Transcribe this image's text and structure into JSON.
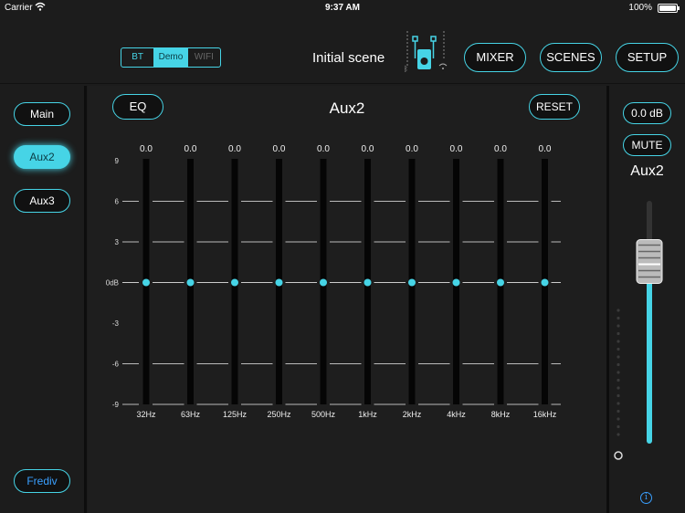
{
  "status": {
    "carrier": "Carrier",
    "time": "9:37 AM",
    "battery": "100%"
  },
  "header": {
    "connection_modes": [
      {
        "label": "BT",
        "active": false
      },
      {
        "label": "Demo",
        "active": true
      },
      {
        "label": "WIFI",
        "active": false
      }
    ],
    "scene_name": "Initial scene",
    "nav": {
      "mixer": "MIXER",
      "scenes": "SCENES",
      "setup": "SETUP"
    }
  },
  "sidebar": {
    "channels": [
      {
        "label": "Main",
        "active": false
      },
      {
        "label": "Aux2",
        "active": true
      },
      {
        "label": "Aux3",
        "active": false
      }
    ],
    "frediv": "Frediv"
  },
  "eq": {
    "mode_label": "EQ",
    "title": "Aux2",
    "reset_label": "RESET",
    "scale_labels": [
      "9",
      "6",
      "3",
      "0dB",
      "-3",
      "-6",
      "-9"
    ],
    "scale_values": [
      9,
      6,
      3,
      0,
      -3,
      -6,
      -9
    ],
    "bands": [
      {
        "freq": "32Hz",
        "gain_label": "0.0",
        "gain": 0
      },
      {
        "freq": "63Hz",
        "gain_label": "0.0",
        "gain": 0
      },
      {
        "freq": "125Hz",
        "gain_label": "0.0",
        "gain": 0
      },
      {
        "freq": "250Hz",
        "gain_label": "0.0",
        "gain": 0
      },
      {
        "freq": "500Hz",
        "gain_label": "0.0",
        "gain": 0
      },
      {
        "freq": "1kHz",
        "gain_label": "0.0",
        "gain": 0
      },
      {
        "freq": "2kHz",
        "gain_label": "0.0",
        "gain": 0
      },
      {
        "freq": "4kHz",
        "gain_label": "0.0",
        "gain": 0
      },
      {
        "freq": "8kHz",
        "gain_label": "0.0",
        "gain": 0
      },
      {
        "freq": "16kHz",
        "gain_label": "0.0",
        "gain": 0
      }
    ]
  },
  "channel_strip": {
    "level_label": "0.0 dB",
    "mute_label": "MUTE",
    "name": "Aux2",
    "fader_level": 0.75,
    "meter_level": 0
  },
  "colors": {
    "accent": "#46d4e6",
    "link": "#3aa0ff",
    "background": "#1c1c1c"
  }
}
